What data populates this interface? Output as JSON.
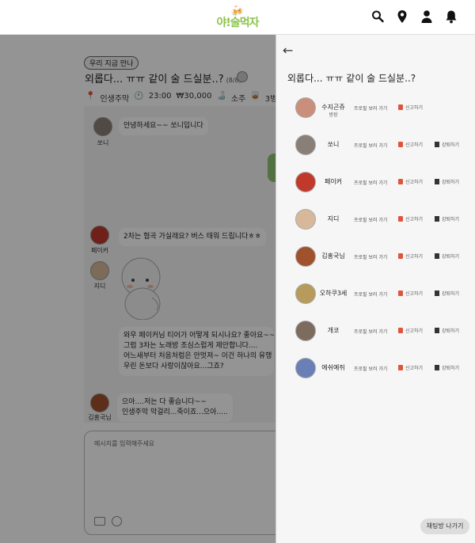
{
  "header": {
    "logo_text": "야!술먹자",
    "logo_mugs": "🍻",
    "icons": [
      "search-icon",
      "location-pin-icon",
      "user-icon",
      "bell-icon"
    ]
  },
  "room": {
    "tag": "우리 지금 만나",
    "title": "외롭다... ㅠㅠ 같이 술 드실분..?",
    "count": "(8/8)",
    "info": {
      "place": "인생주막",
      "time": "23:00",
      "price": "₩30,000",
      "drink": "소주",
      "bottles": "3병"
    }
  },
  "chat": {
    "messages": [
      {
        "name": "쏘니",
        "text": "안녕하세요~~ 쏘니입니다"
      },
      {
        "name": "페이커",
        "text": "2차는 협곡 가실래요? 버스 태워 드립니다ㅎㅎ"
      },
      {
        "name": "지디",
        "lines": [
          "와우 페이커님 티어가 어떻게 되시나요? 좋아요~~",
          "그럼 3차는 노래방 조심스럽게 제안합니다....",
          "어느새부터 처음처럼은 안멋져~ 이건 하나의 유행",
          "우린 돈보다 사랑이잖아요...그죠?"
        ]
      },
      {
        "name": "김홍국님",
        "lines": [
          "으아....저는 다 좋습니다~~",
          "인생주막 막걸리...죽이죠...으아....."
        ]
      }
    ],
    "input_placeholder": "메시지를 입력해주세요"
  },
  "panel": {
    "title": "외롭다... ㅠㅠ 같이 술 드실분..?",
    "profile_label": "프로필 보러 가기",
    "report_label": "신고하기",
    "kick_label": "강퇴하기",
    "members": [
      {
        "name": "수지곤쥬",
        "sub": "방장",
        "color": "#c98f7a"
      },
      {
        "name": "쏘니",
        "color": "#8a7f76"
      },
      {
        "name": "페이커",
        "color": "#c0392b"
      },
      {
        "name": "지디",
        "color": "#d8b89a"
      },
      {
        "name": "김홍국님",
        "color": "#a0522d"
      },
      {
        "name": "오하쿠3세",
        "color": "#b79b5c"
      },
      {
        "name": "개코",
        "color": "#7d6b5e"
      },
      {
        "name": "에쉬예쥐",
        "color": "#6a7fb5"
      }
    ],
    "leave_button": "채팅방 나가기"
  }
}
